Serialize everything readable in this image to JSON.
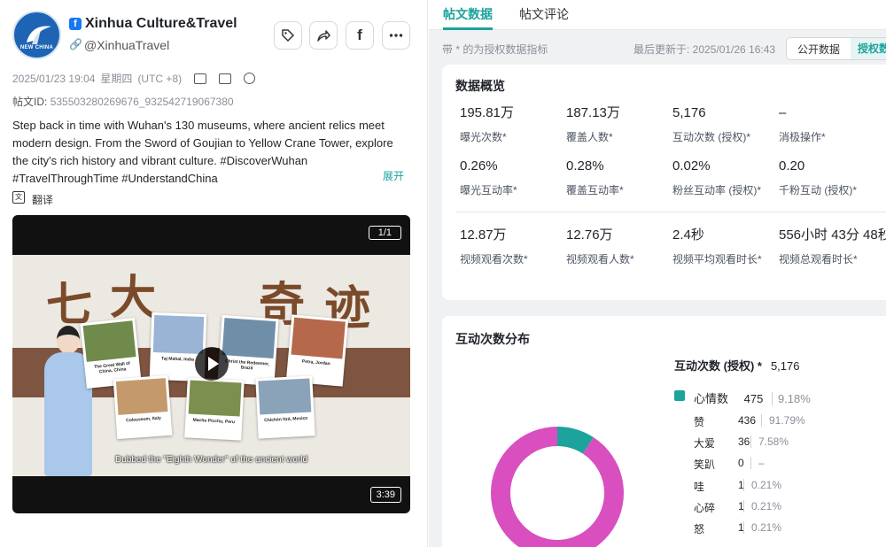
{
  "account": {
    "name": "Xinhua Culture&Travel",
    "handle": "@XinhuaTravel",
    "avatar_text": "NEW CHINA",
    "platform_icon": "facebook-icon"
  },
  "post": {
    "datetime": "2025/01/23 19:04",
    "weekday": "星期四",
    "tz": "(UTC +8)",
    "id_label": "帖文ID:",
    "id_value": "535503280269676_932542719067380",
    "text": "Step back in time with Wuhan's 130 museums, where ancient relics meet modern design. From the Sword of Goujian to Yellow Crane Tower, explore the city's rich history and vibrant culture. #DiscoverWuhan #TravelThroughTime #UnderstandChina",
    "expand_label": "展开",
    "translate_label": "翻译"
  },
  "video": {
    "count": "1/1",
    "duration": "3:39",
    "subtitle": "Dubbed the \"Eighth Wonder\" of the ancient world",
    "title_chars": [
      "七",
      "大",
      "奇",
      "迹"
    ],
    "cards": [
      {
        "caption": "The Great Wall of China, China",
        "color": "#6f8a4a"
      },
      {
        "caption": "Taj Mahal, India",
        "color": "#9ab4d6"
      },
      {
        "caption": "Christ the Redeemer, Brazil",
        "color": "#6f8fa8"
      },
      {
        "caption": "Petra, Jordan",
        "color": "#b5694a"
      },
      {
        "caption": "Colosseum, Italy",
        "color": "#c49a6c"
      },
      {
        "caption": "Machu Picchu, Peru",
        "color": "#7d8f4e"
      },
      {
        "caption": "Chichén Itzá, Mexico",
        "color": "#8aa3b8"
      }
    ]
  },
  "tabs": [
    {
      "label": "帖文数据",
      "active": true
    },
    {
      "label": "帖文评论",
      "active": false
    }
  ],
  "info": {
    "note": "带 * 的为授权数据指标",
    "updated": "最后更新于: 2025/01/26 16:43",
    "toggle_public": "公开数据",
    "toggle_auth": "授权数"
  },
  "overview": {
    "title": "数据概览",
    "metrics": [
      {
        "value": "195.81万",
        "label": "曝光次数*"
      },
      {
        "value": "187.13万",
        "label": "覆盖人数*"
      },
      {
        "value": "5,176",
        "label": "互动次数 (授权)*"
      },
      {
        "value": "–",
        "label": "消极操作*"
      },
      {
        "value": "0.26%",
        "label": "曝光互动率*"
      },
      {
        "value": "0.28%",
        "label": "覆盖互动率*"
      },
      {
        "value": "0.02%",
        "label": "粉丝互动率 (授权)*"
      },
      {
        "value": "0.20",
        "label": "千粉互动 (授权)*"
      },
      {
        "value": "12.87万",
        "label": "视频观看次数*"
      },
      {
        "value": "12.76万",
        "label": "视频观看人数*"
      },
      {
        "value": "2.4秒",
        "label": "视频平均观看时长*"
      },
      {
        "value": "556小时 43分 48秒",
        "label": "视频总观看时长*"
      }
    ]
  },
  "distribution": {
    "title": "互动次数分布",
    "total_label": "互动次数 (授权) *",
    "total_value": "5,176",
    "reactions": {
      "name": "心情数",
      "count": "475",
      "pct": "9.18%",
      "color": "#1ba39c",
      "rows": [
        {
          "label": "赞",
          "count": "436",
          "pct": "91.79%"
        },
        {
          "label": "大爱",
          "count": "36",
          "pct": "7.58%"
        },
        {
          "label": "笑趴",
          "count": "0",
          "pct": "–"
        },
        {
          "label": "哇",
          "count": "1",
          "pct": "0.21%"
        },
        {
          "label": "心碎",
          "count": "1",
          "pct": "0.21%"
        },
        {
          "label": "怒",
          "count": "1",
          "pct": "0.21%"
        }
      ]
    },
    "donut_colors": {
      "reactions": "#1ba39c",
      "other": "#d94fbf"
    },
    "chart_data": {
      "type": "pie",
      "series": [
        {
          "name": "心情数",
          "value": 9.18
        },
        {
          "value": 90.82
        }
      ]
    }
  }
}
